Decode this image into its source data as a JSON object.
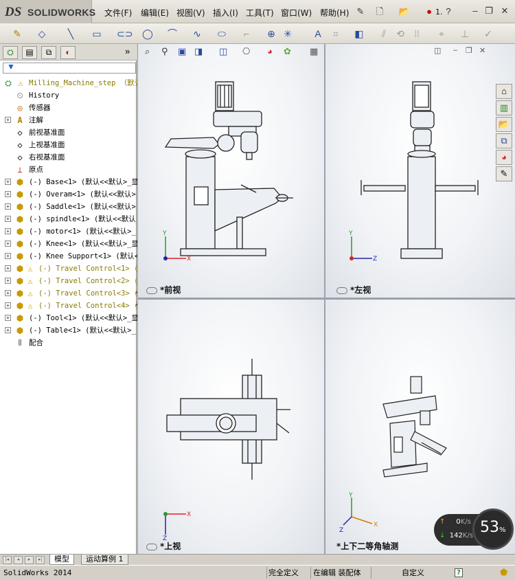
{
  "app": {
    "logo_ds": "DS",
    "logo_name": "SOLIDWORKS"
  },
  "menu": [
    {
      "label": "文件(F)"
    },
    {
      "label": "编辑(E)"
    },
    {
      "label": "视图(V)"
    },
    {
      "label": "插入(I)"
    },
    {
      "label": "工具(T)"
    },
    {
      "label": "窗口(W)"
    },
    {
      "label": "帮助(H)"
    }
  ],
  "title_suffix": "1.",
  "feature_tree": {
    "root": "Milling_Machine_step （默认",
    "items": [
      {
        "label": "History",
        "icon": "history-icon"
      },
      {
        "label": "传感器",
        "icon": "sensor-icon"
      },
      {
        "label": "注解",
        "icon": "annotation-icon"
      },
      {
        "label": "前视基准面",
        "icon": "plane-icon"
      },
      {
        "label": "上视基准面",
        "icon": "plane-icon"
      },
      {
        "label": "右视基准面",
        "icon": "plane-icon"
      },
      {
        "label": "原点",
        "icon": "origin-icon"
      },
      {
        "label": "(-) Base<1> (默认<<默认>_显",
        "icon": "part-icon"
      },
      {
        "label": "(-) Overam<1> (默认<<默认>",
        "icon": "part-icon"
      },
      {
        "label": "(-) Saddle<1> (默认<<默认>",
        "icon": "part-icon"
      },
      {
        "label": "(-) spindle<1> (默认<<默认",
        "icon": "part-icon"
      },
      {
        "label": "(-) motor<1> (默认<<默认>_",
        "icon": "part-icon"
      },
      {
        "label": "(-) Knee<1> (默认<<默认>_显",
        "icon": "part-icon"
      },
      {
        "label": "(-) Knee Support<1> (默认<",
        "icon": "part-icon"
      },
      {
        "label": "(-) Travel Control<1> (",
        "icon": "warning-part-icon"
      },
      {
        "label": "(-) Travel Control<2> (",
        "icon": "warning-part-icon"
      },
      {
        "label": "(-) Travel Control<3> (",
        "icon": "warning-part-icon"
      },
      {
        "label": "(-) Travel Control<4> (",
        "icon": "warning-part-icon"
      },
      {
        "label": "(-) Tool<1> (默认<<默认>_显",
        "icon": "part-icon"
      },
      {
        "label": "(-) Table<1> (默认<<默认>_",
        "icon": "part-icon"
      },
      {
        "label": "配合",
        "icon": "mates-icon"
      }
    ]
  },
  "viewports": {
    "front": "*前视",
    "left": "*左视",
    "top": "*上视",
    "iso": "*上下二等角轴测"
  },
  "bottom_tabs": {
    "model": "模型",
    "motion": "运动算例 1"
  },
  "status": {
    "app": "SolidWorks 2014",
    "defined": "完全定义",
    "editing": "在编辑 装配体",
    "custom": "自定义",
    "help": "?"
  },
  "network": {
    "upload": "0",
    "upload_unit": "K/s",
    "download": "142",
    "download_unit": "K/s",
    "percent": "53",
    "percent_unit": "%"
  }
}
